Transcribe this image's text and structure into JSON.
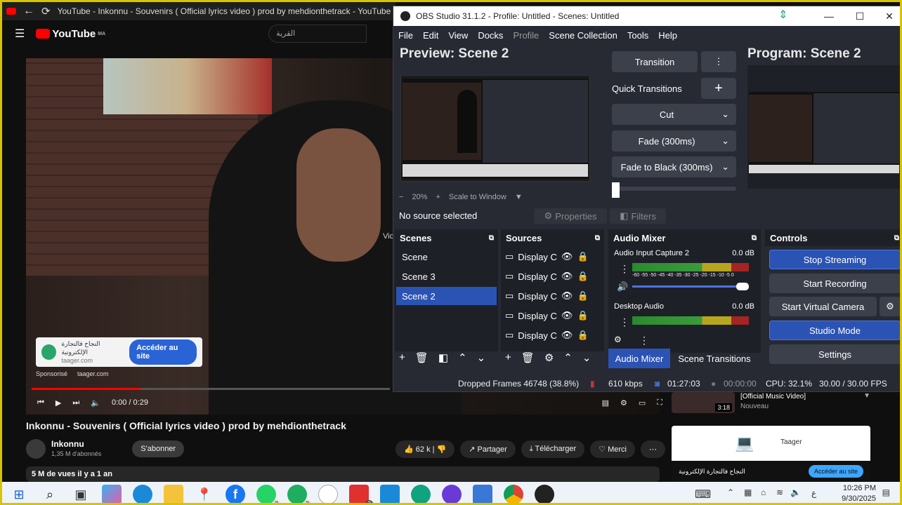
{
  "browser": {
    "tab_title": "YouTube - Inkonnu - Souvenirs ( Official lyrics video ) prod by mehdionthetrack - YouTube",
    "youtube_logo": "YouTube",
    "region_badge": "MA",
    "search_placeholder": "القرية"
  },
  "video": {
    "ad": {
      "title": "النجاح فالتجارة الإلكترونية",
      "domain": "taager.com",
      "button": "Accéder au site",
      "sponsored": "Sponsorisé",
      "sponsor_domain": "taager.com"
    },
    "time": "0:00 / 0:29",
    "title": "Inkonnu - Souvenirs ( Official lyrics video ) prod by mehdionthetrack",
    "channel": "Inkonnu",
    "subscribers": "1,35 M d'abonnés",
    "subscribe_button": "S'abonner",
    "likes": "62 k",
    "share": "Partager",
    "download": "Télécharger",
    "thanks": "Merci",
    "views": "5 M de vues  il y a 1 an",
    "overlay_text": "Vic"
  },
  "sidebar": {
    "duration": "3:18",
    "related_title": "[Official Music Video]",
    "related_meta": "Nouveau",
    "ad_brand": "Taager",
    "ad_title": "النجاح فالتجارة الإلكترونية",
    "ad_button": "Accéder au site"
  },
  "obs": {
    "window_title": "OBS Studio 31.1.2 - Profile: Untitled - Scenes: Untitled",
    "menu": [
      "File",
      "Edit",
      "View",
      "Docks",
      "Profile",
      "Scene Collection",
      "Tools",
      "Help"
    ],
    "preview_title": "Preview: Scene 2",
    "program_title": "Program: Scene 2",
    "transition_button": "Transition",
    "quick_transitions": "Quick Transitions",
    "transitions": [
      "Cut",
      "Fade (300ms)",
      "Fade to Black (300ms)"
    ],
    "zoom": "20%",
    "scale_mode": "Scale to Window",
    "no_source": "No source selected",
    "properties": "Properties",
    "filters": "Filters",
    "docks": {
      "scenes": "Scenes",
      "sources": "Sources",
      "mixer": "Audio Mixer",
      "controls": "Controls"
    },
    "scenes": [
      "Scene",
      "Scene 3",
      "Scene 2"
    ],
    "sources": [
      "Display C",
      "Display C",
      "Display C",
      "Display C",
      "Display C"
    ],
    "mixer_channels": [
      {
        "name": "Audio Input Capture 2",
        "level": "0.0 dB"
      },
      {
        "name": "Desktop Audio",
        "level": "0.0 dB"
      }
    ],
    "meter_scale": "-60 -55 -50 -45 -40 -35 -30 -25 -20 -15 -10 -5 0",
    "mixer_tabs": [
      "Audio Mixer",
      "Scene Transitions"
    ],
    "controls": [
      "Stop Streaming",
      "Start Recording",
      "Start Virtual Camera",
      "Studio Mode",
      "Settings"
    ],
    "status": {
      "dropped": "Dropped Frames 46748 (38.8%)",
      "bitrate": "610 kbps",
      "stream_time": "01:27:03",
      "rec_time": "00:00:00",
      "cpu": "CPU: 32.1%",
      "fps": "30.00 / 30.00 FPS"
    }
  },
  "taskbar": {
    "time": "10:26 PM",
    "date": "9/30/2025",
    "badges": [
      "3",
      "3",
      "2"
    ],
    "lang": "ع"
  },
  "colors": {
    "obs_bg": "#272a33",
    "obs_accent": "#2b53b3",
    "yt_red": "#ff0000",
    "border_yellow": "#d8c400"
  }
}
